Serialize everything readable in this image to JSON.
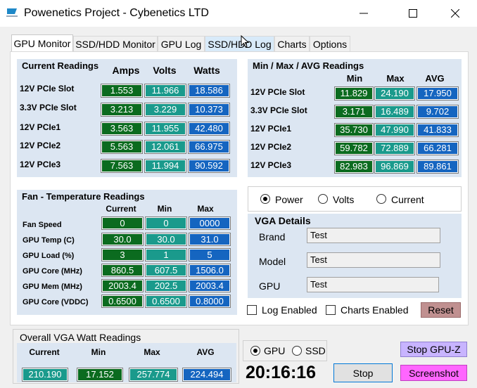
{
  "window": {
    "title": "Powenetics Project - Cybenetics LTD",
    "icon_caption": "Cybenetics"
  },
  "tabs": [
    {
      "label": "GPU Monitor"
    },
    {
      "label": "SSD/HDD Monitor"
    },
    {
      "label": "GPU Log"
    },
    {
      "label": "SSD/HDD Log"
    },
    {
      "label": "Charts"
    },
    {
      "label": "Options"
    }
  ],
  "current": {
    "title": "Current Readings",
    "headers": [
      "Amps",
      "Volts",
      "Watts"
    ],
    "rows": [
      {
        "label": "12V PCIe Slot",
        "amps": "1.553",
        "volts": "11.966",
        "watts": "18.586"
      },
      {
        "label": "3.3V PCIe Slot",
        "amps": "3.213",
        "volts": "3.229",
        "watts": "10.373"
      },
      {
        "label": "12V PCIe1",
        "amps": "3.563",
        "volts": "11.955",
        "watts": "42.480"
      },
      {
        "label": "12V PCIe2",
        "amps": "5.563",
        "volts": "12.061",
        "watts": "66.975"
      },
      {
        "label": "12V PCIe3",
        "amps": "7.563",
        "volts": "11.994",
        "watts": "90.592"
      }
    ]
  },
  "minmax": {
    "title": "Min / Max / AVG Readings",
    "headers": [
      "Min",
      "Max",
      "AVG"
    ],
    "rows": [
      {
        "label": "12V PCIe Slot",
        "min": "11.829",
        "max": "24.190",
        "avg": "17.950"
      },
      {
        "label": "3.3V PCIe Slot",
        "min": "3.171",
        "max": "16.489",
        "avg": "9.702"
      },
      {
        "label": "12V PCIe1",
        "min": "35.730",
        "max": "47.990",
        "avg": "41.833"
      },
      {
        "label": "12V PCIe2",
        "min": "59.782",
        "max": "72.889",
        "avg": "66.281"
      },
      {
        "label": "12V PCIe3",
        "min": "82.983",
        "max": "96.869",
        "avg": "89.861"
      }
    ]
  },
  "fan": {
    "title": "Fan - Temperature Readings",
    "headers": [
      "Current",
      "Min",
      "Max"
    ],
    "rows": [
      {
        "label": "Fan Speed",
        "current": "0",
        "min": "0",
        "max": "0000"
      },
      {
        "label": "GPU Temp (C)",
        "current": "30.0",
        "min": "30.0",
        "max": "31.0"
      },
      {
        "label": "GPU Load (%)",
        "current": "3",
        "min": "1",
        "max": "5"
      },
      {
        "label": "GPU Core (MHz)",
        "current": "860.5",
        "min": "607.5",
        "max": "1506.0"
      },
      {
        "label": "GPU Mem (MHz)",
        "current": "2003.4",
        "min": "202.5",
        "max": "2003.4"
      },
      {
        "label": "GPU Core (VDDC)",
        "current": "0.6500",
        "min": "0.6500",
        "max": "0.8000"
      }
    ]
  },
  "mode": {
    "options": [
      "Power",
      "Volts",
      "Current"
    ],
    "selected": "Power"
  },
  "vga": {
    "title": "VGA Details",
    "fields": [
      {
        "label": "Brand",
        "value": "Test"
      },
      {
        "label": "Model",
        "value": "Test"
      },
      {
        "label": "GPU",
        "value": "Test"
      }
    ]
  },
  "log": {
    "log_label": "Log Enabled",
    "charts_label": "Charts Enabled",
    "reset_label": "Reset"
  },
  "overall": {
    "title": "Overall VGA Watt Readings",
    "headers": [
      "Current",
      "Min",
      "Max",
      "AVG"
    ],
    "values": [
      "210.190",
      "17.152",
      "257.774",
      "224.494"
    ]
  },
  "device": {
    "options": [
      "GPU",
      "SSD"
    ],
    "selected": "GPU"
  },
  "controls": {
    "clock": "20:16:16",
    "stop_label": "Stop",
    "stop_gpuz_label": "Stop GPU-Z",
    "screenshot_label": "Screenshot"
  },
  "colors": {
    "green": "#0b6b1f",
    "teal": "#1a9a8c",
    "blue": "#1565c0",
    "panel": "#dce6f2",
    "screenshot": "#ff66ff",
    "stop_gpuz": "#c8b4ff",
    "reset": "#c09090"
  }
}
